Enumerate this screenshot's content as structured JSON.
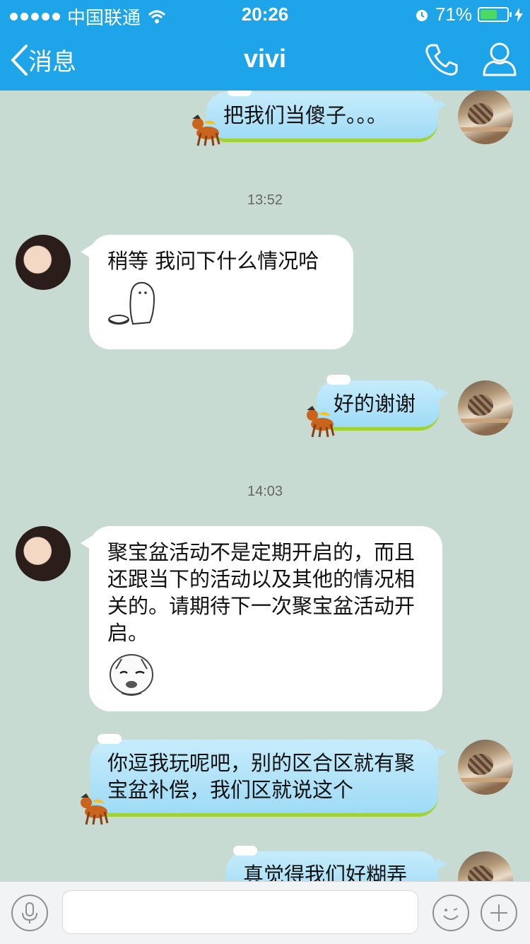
{
  "status_bar": {
    "carrier": "中国联通",
    "time": "20:26",
    "battery": "71%",
    "battery_level": 0.71
  },
  "nav": {
    "back_label": "消息",
    "title": "vivi"
  },
  "messages": [
    {
      "dir": "out",
      "text": "把我们当傻子。。。"
    },
    {
      "type": "time",
      "text": "13:52"
    },
    {
      "dir": "in",
      "text": "稍等 我问下什么情况哈",
      "sticker": "ghost-bowl-sticker"
    },
    {
      "dir": "out",
      "text": "好的谢谢"
    },
    {
      "type": "time",
      "text": "14:03"
    },
    {
      "dir": "in",
      "text": "聚宝盆活动不是定期开启的，而且还跟当下的活动以及其他的情况相关的。请期待下一次聚宝盆活动开启。",
      "sticker": "bald-baby-face-sticker"
    },
    {
      "dir": "out",
      "text": "你逗我玩呢吧，别的区合区就有聚宝盆补偿，我们区就说这个"
    },
    {
      "dir": "out",
      "text": "真觉得我们好糊弄"
    }
  ],
  "input_bar": {
    "placeholder": ""
  },
  "colors": {
    "nav_bg": "#1ea4e8",
    "chat_bg": "#c7dbd3",
    "out_bubble": "#b3e3f8",
    "in_bubble": "#ffffff",
    "bubble_accent": "#9ed236"
  }
}
